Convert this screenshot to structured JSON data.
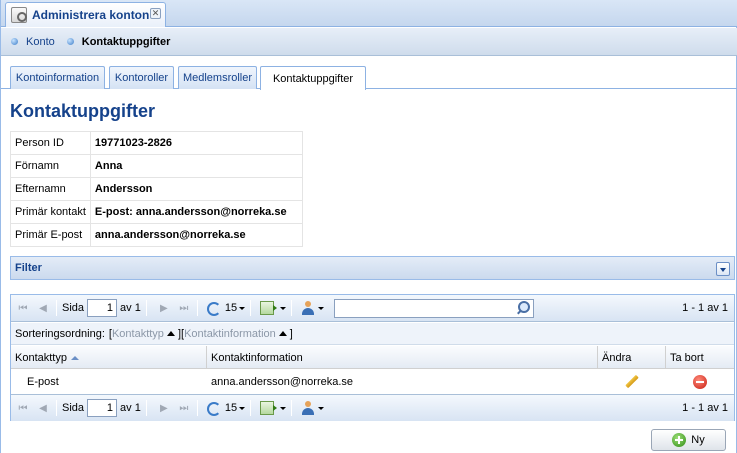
{
  "app_tab": {
    "title": "Administrera konton",
    "close_symbol": "✕"
  },
  "breadcrumb": {
    "items": [
      "Konto",
      "Kontaktuppgifter"
    ]
  },
  "subtabs": [
    {
      "label": "Kontoinformation",
      "active": false
    },
    {
      "label": "Kontoroller",
      "active": false
    },
    {
      "label": "Medlemsroller",
      "active": false
    },
    {
      "label": "Kontaktuppgifter",
      "active": true
    }
  ],
  "page_title": "Kontaktuppgifter",
  "person": {
    "rows": [
      {
        "key": "Person ID",
        "value": "19771023-2826"
      },
      {
        "key": "Förnamn",
        "value": "Anna"
      },
      {
        "key": "Efternamn",
        "value": "Andersson"
      },
      {
        "key": "Primär kontakt",
        "value": "E-post: anna.andersson@norreka.se"
      },
      {
        "key": "Primär E-post",
        "value": "anna.andersson@norreka.se"
      }
    ]
  },
  "filter": {
    "label": "Filter"
  },
  "pager": {
    "page_label": "Sida",
    "page_value": "1",
    "of_label": "av 1",
    "page_size": "15",
    "info": "1 - 1 av 1",
    "search_placeholder": ""
  },
  "sort": {
    "label": "Sorteringsordning:",
    "items": [
      "Kontakttyp",
      "Kontaktinformation"
    ]
  },
  "grid": {
    "columns": [
      "Kontakttyp",
      "Kontaktinformation",
      "Ändra",
      "Ta bort"
    ],
    "rows": [
      {
        "type": "E-post",
        "info": "anna.andersson@norreka.se"
      }
    ]
  },
  "new_button": {
    "label": "Ny"
  },
  "icons": {
    "first": "⏮",
    "prev": "◀",
    "next": "▶",
    "last": "⏭"
  }
}
